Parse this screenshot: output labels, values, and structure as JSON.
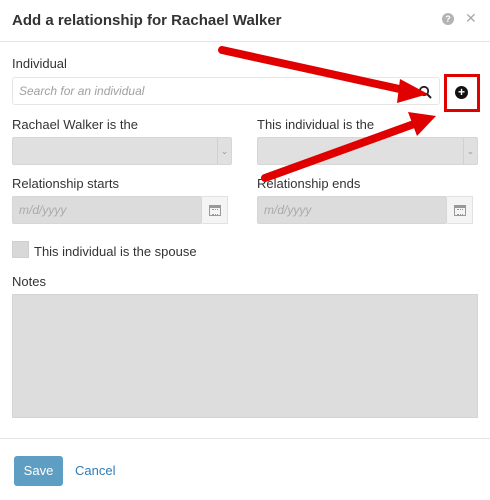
{
  "dialog": {
    "title": "Add a relationship for Rachael Walker",
    "help_glyph": "?",
    "close_glyph": "✕"
  },
  "individual": {
    "label": "Individual",
    "search_placeholder": "Search for an individual",
    "add_glyph": "+"
  },
  "relationship": {
    "left_label": "Rachael Walker is the",
    "right_label": "This individual is the",
    "left_value": "",
    "right_value": ""
  },
  "dates": {
    "start_label": "Relationship starts",
    "end_label": "Relationship ends",
    "start_placeholder": "m/d/yyyy",
    "end_placeholder": "m/d/yyyy"
  },
  "spouse": {
    "label": "This individual is the spouse",
    "checked": false
  },
  "notes": {
    "label": "Notes",
    "value": ""
  },
  "footer": {
    "save_label": "Save",
    "cancel_label": "Cancel"
  },
  "colors": {
    "accent": "#5f9ec3",
    "link": "#2f7cb6",
    "highlight": "#e00000"
  },
  "icons": [
    "help-icon",
    "close-icon",
    "search-icon",
    "add-circle-icon",
    "calendar-icon",
    "chevron-down-icon",
    "arrow-annotation"
  ]
}
